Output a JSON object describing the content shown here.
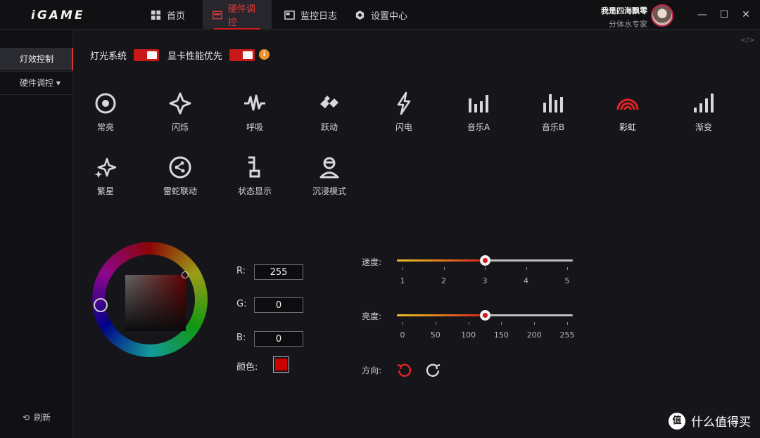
{
  "app": {
    "logo": "iGAME"
  },
  "nav": {
    "tabs": [
      {
        "label": "首页",
        "icon": "home-grid-icon"
      },
      {
        "label": "硬件调控",
        "icon": "hardware-card-icon",
        "active": true
      },
      {
        "label": "监控日志",
        "icon": "monitor-log-icon"
      },
      {
        "label": "设置中心",
        "icon": "settings-hex-icon"
      }
    ]
  },
  "user": {
    "name": "我是四海飘零",
    "title": "分体水专家"
  },
  "window": {
    "minimize": "—",
    "maximize": "☐",
    "close": "✕"
  },
  "sidebar": {
    "items": [
      {
        "label": "灯效控制",
        "active": true
      },
      {
        "label": "硬件调控 ▾"
      }
    ],
    "refresh": "刷新",
    "refresh_glyph": "⟲"
  },
  "toggles": {
    "lighting": {
      "label": "灯光系统",
      "on": true
    },
    "gpu_priority": {
      "label": "显卡性能优先",
      "on": true
    },
    "info_glyph": "i"
  },
  "code_glyph": "</>",
  "effects": [
    {
      "label": "常亮",
      "icon": "steady-circle-icon"
    },
    {
      "label": "闪烁",
      "icon": "flash-sparkle-icon"
    },
    {
      "label": "呼吸",
      "icon": "breath-wave-icon"
    },
    {
      "label": "跃动",
      "icon": "jump-diamond-icon"
    },
    {
      "label": "闪电",
      "icon": "lightning-icon"
    },
    {
      "label": "音乐A",
      "icon": "music-bars-a-icon"
    },
    {
      "label": "音乐B",
      "icon": "music-bars-b-icon"
    },
    {
      "label": "彩虹",
      "icon": "rainbow-arc-icon",
      "selected": true
    },
    {
      "label": "渐变",
      "icon": "gradient-bars-icon"
    },
    {
      "label": "繁星",
      "icon": "stars-icon"
    },
    {
      "label": "雷蛇联动",
      "icon": "razer-sync-icon"
    },
    {
      "label": "状态显示",
      "icon": "status-display-icon"
    },
    {
      "label": "沉浸模式",
      "icon": "immersive-person-icon"
    }
  ],
  "color": {
    "r_label": "R:",
    "r": "255",
    "g_label": "G:",
    "g": "0",
    "b_label": "B:",
    "b": "0",
    "swatch_label": "颜色:",
    "swatch_color": "#cc0000"
  },
  "speed": {
    "label": "速度:",
    "ticks": [
      "1",
      "2",
      "3",
      "4",
      "5"
    ],
    "value": 3,
    "min": 1,
    "max": 5
  },
  "brightness": {
    "label": "亮度:",
    "ticks": [
      "0",
      "50",
      "100",
      "150",
      "200",
      "255"
    ],
    "value": 128,
    "min": 0,
    "max": 255
  },
  "direction": {
    "label": "方向:"
  },
  "watermark": {
    "glyph": "值",
    "text": "什么值得买"
  },
  "colors": {
    "accent": "#d01c1c",
    "background": "#16161a",
    "info": "#f0922b"
  }
}
